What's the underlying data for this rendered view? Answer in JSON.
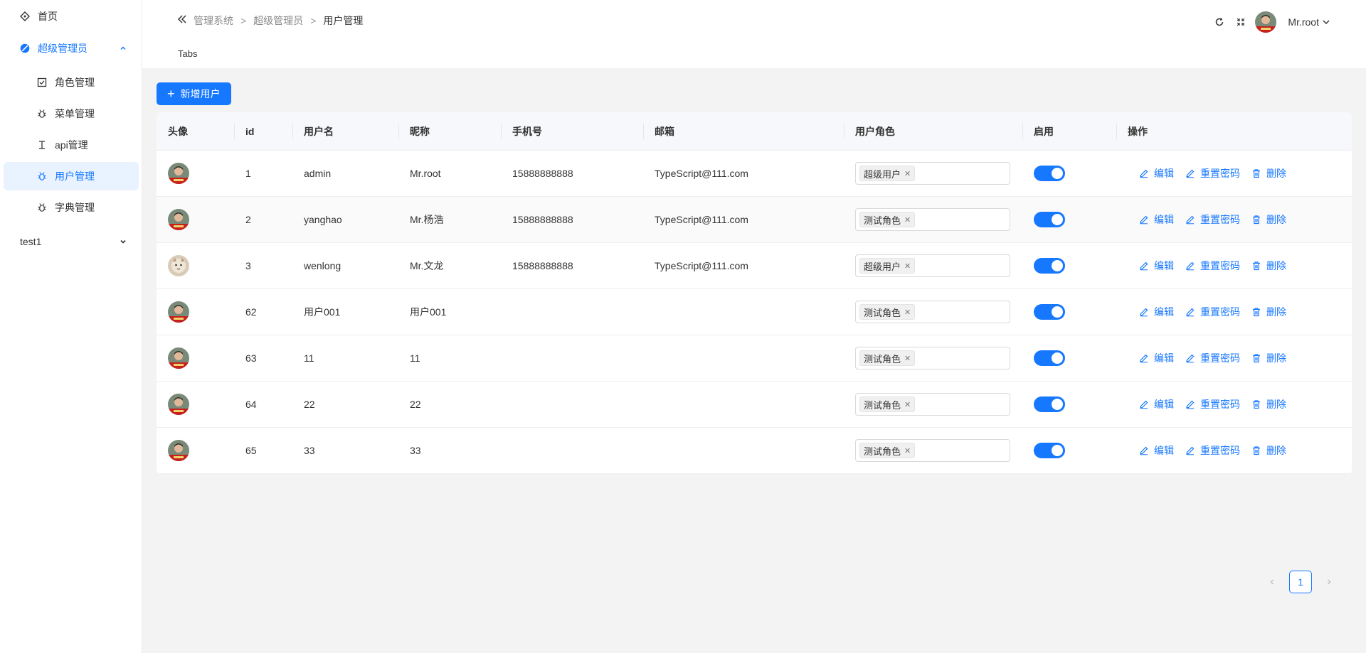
{
  "sidebar": {
    "home": "首页",
    "super_admin": "超级管理员",
    "sub_items": [
      {
        "label": "角色管理",
        "icon": "checkbox-icon"
      },
      {
        "label": "菜单管理",
        "icon": "bug-icon"
      },
      {
        "label": "api管理",
        "icon": "text-cursor-icon"
      },
      {
        "label": "用户管理",
        "icon": "bug-icon"
      },
      {
        "label": "字典管理",
        "icon": "bug-icon"
      }
    ],
    "test_group": "test1"
  },
  "header": {
    "breadcrumb": [
      "管理系统",
      "超级管理员",
      "用户管理"
    ],
    "separator": ">",
    "tabs_label": "Tabs",
    "user_name": "Mr.root"
  },
  "toolbar": {
    "add_label": "新增用户"
  },
  "table": {
    "columns": [
      "头像",
      "id",
      "用户名",
      "昵称",
      "手机号",
      "邮箱",
      "用户角色",
      "启用",
      "操作"
    ],
    "actions": {
      "edit": "编辑",
      "reset": "重置密码",
      "delete": "删除"
    },
    "rows": [
      {
        "id": "1",
        "username": "admin",
        "nickname": "Mr.root",
        "phone": "15888888888",
        "email": "TypeScript@111.com",
        "role": "超级用户",
        "enabled": true
      },
      {
        "id": "2",
        "username": "yanghao",
        "nickname": "Mr.杨浩",
        "phone": "15888888888",
        "email": "TypeScript@111.com",
        "role": "测试角色",
        "enabled": true
      },
      {
        "id": "3",
        "username": "wenlong",
        "nickname": "Mr.文龙",
        "phone": "15888888888",
        "email": "TypeScript@111.com",
        "role": "超级用户",
        "enabled": true
      },
      {
        "id": "62",
        "username": "用户001",
        "nickname": "用户001",
        "phone": "",
        "email": "",
        "role": "测试角色",
        "enabled": true
      },
      {
        "id": "63",
        "username": "11",
        "nickname": "11",
        "phone": "",
        "email": "",
        "role": "测试角色",
        "enabled": true
      },
      {
        "id": "64",
        "username": "22",
        "nickname": "22",
        "phone": "",
        "email": "",
        "role": "测试角色",
        "enabled": true
      },
      {
        "id": "65",
        "username": "33",
        "nickname": "33",
        "phone": "",
        "email": "",
        "role": "测试角色",
        "enabled": true
      }
    ]
  },
  "pagination": {
    "current": "1"
  },
  "colors": {
    "primary": "#1677ff",
    "active_bg": "#e8f3ff"
  }
}
